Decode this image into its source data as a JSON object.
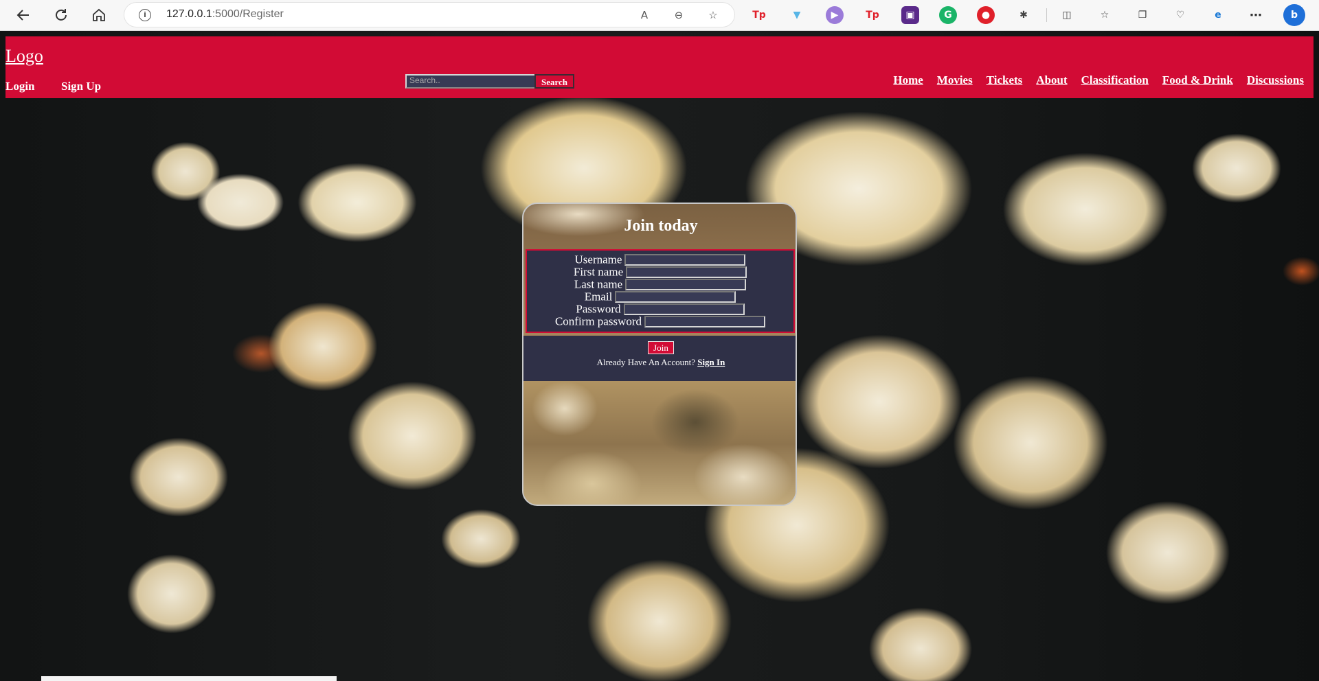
{
  "browser": {
    "url_host": "127.0.0.1",
    "url_path": ":5000/Register"
  },
  "header": {
    "logo": "Logo",
    "login": "Login",
    "signup": "Sign Up",
    "search_placeholder": "Search..",
    "search_button": "Search",
    "nav": [
      "Home",
      "Movies",
      "Tickets",
      "About",
      "Classification",
      "Food & Drink",
      "Discussions"
    ]
  },
  "form": {
    "title": "Join today",
    "fields": {
      "username": "Username",
      "first_name": "First name",
      "last_name": "Last name",
      "email": "Email",
      "password": "Password",
      "confirm_password": "Confirm password"
    },
    "join_button": "Join",
    "already_text": "Already Have An Account?",
    "sign_in_link": "Sign In"
  },
  "colors": {
    "brand_red": "#d20b35",
    "panel": "#2f3047"
  }
}
